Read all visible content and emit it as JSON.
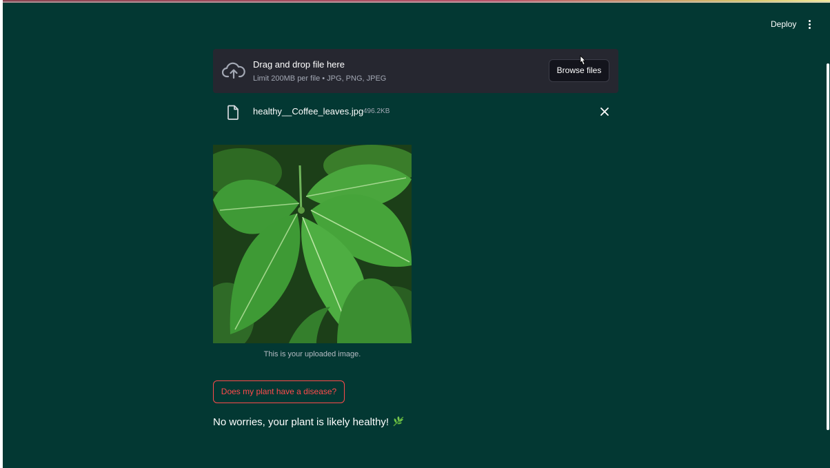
{
  "header": {
    "deploy_label": "Deploy",
    "menu_icon": "kebab-menu-icon"
  },
  "uploader": {
    "icon": "cloud-upload-icon",
    "title": "Drag and drop file here",
    "limit_text": "Limit 200MB per file • JPG, PNG, JPEG",
    "browse_label": "Browse files"
  },
  "file": {
    "icon": "file-icon",
    "name": "healthy__Coffee_leaves.jpg",
    "size": "496.2KB",
    "remove_icon": "close-icon"
  },
  "image": {
    "caption": "This is your uploaded image."
  },
  "actions": {
    "predict_label": "Does my plant have a disease?"
  },
  "result": {
    "text": "No worries, your plant is likely healthy!",
    "emoji_icon": "herb-icon"
  },
  "colors": {
    "app_background": "#033833",
    "uploader_background": "#262730",
    "primary_red": "#ff4b4b",
    "text_white": "#ffffff",
    "muted_text": "#a3a8b4"
  }
}
